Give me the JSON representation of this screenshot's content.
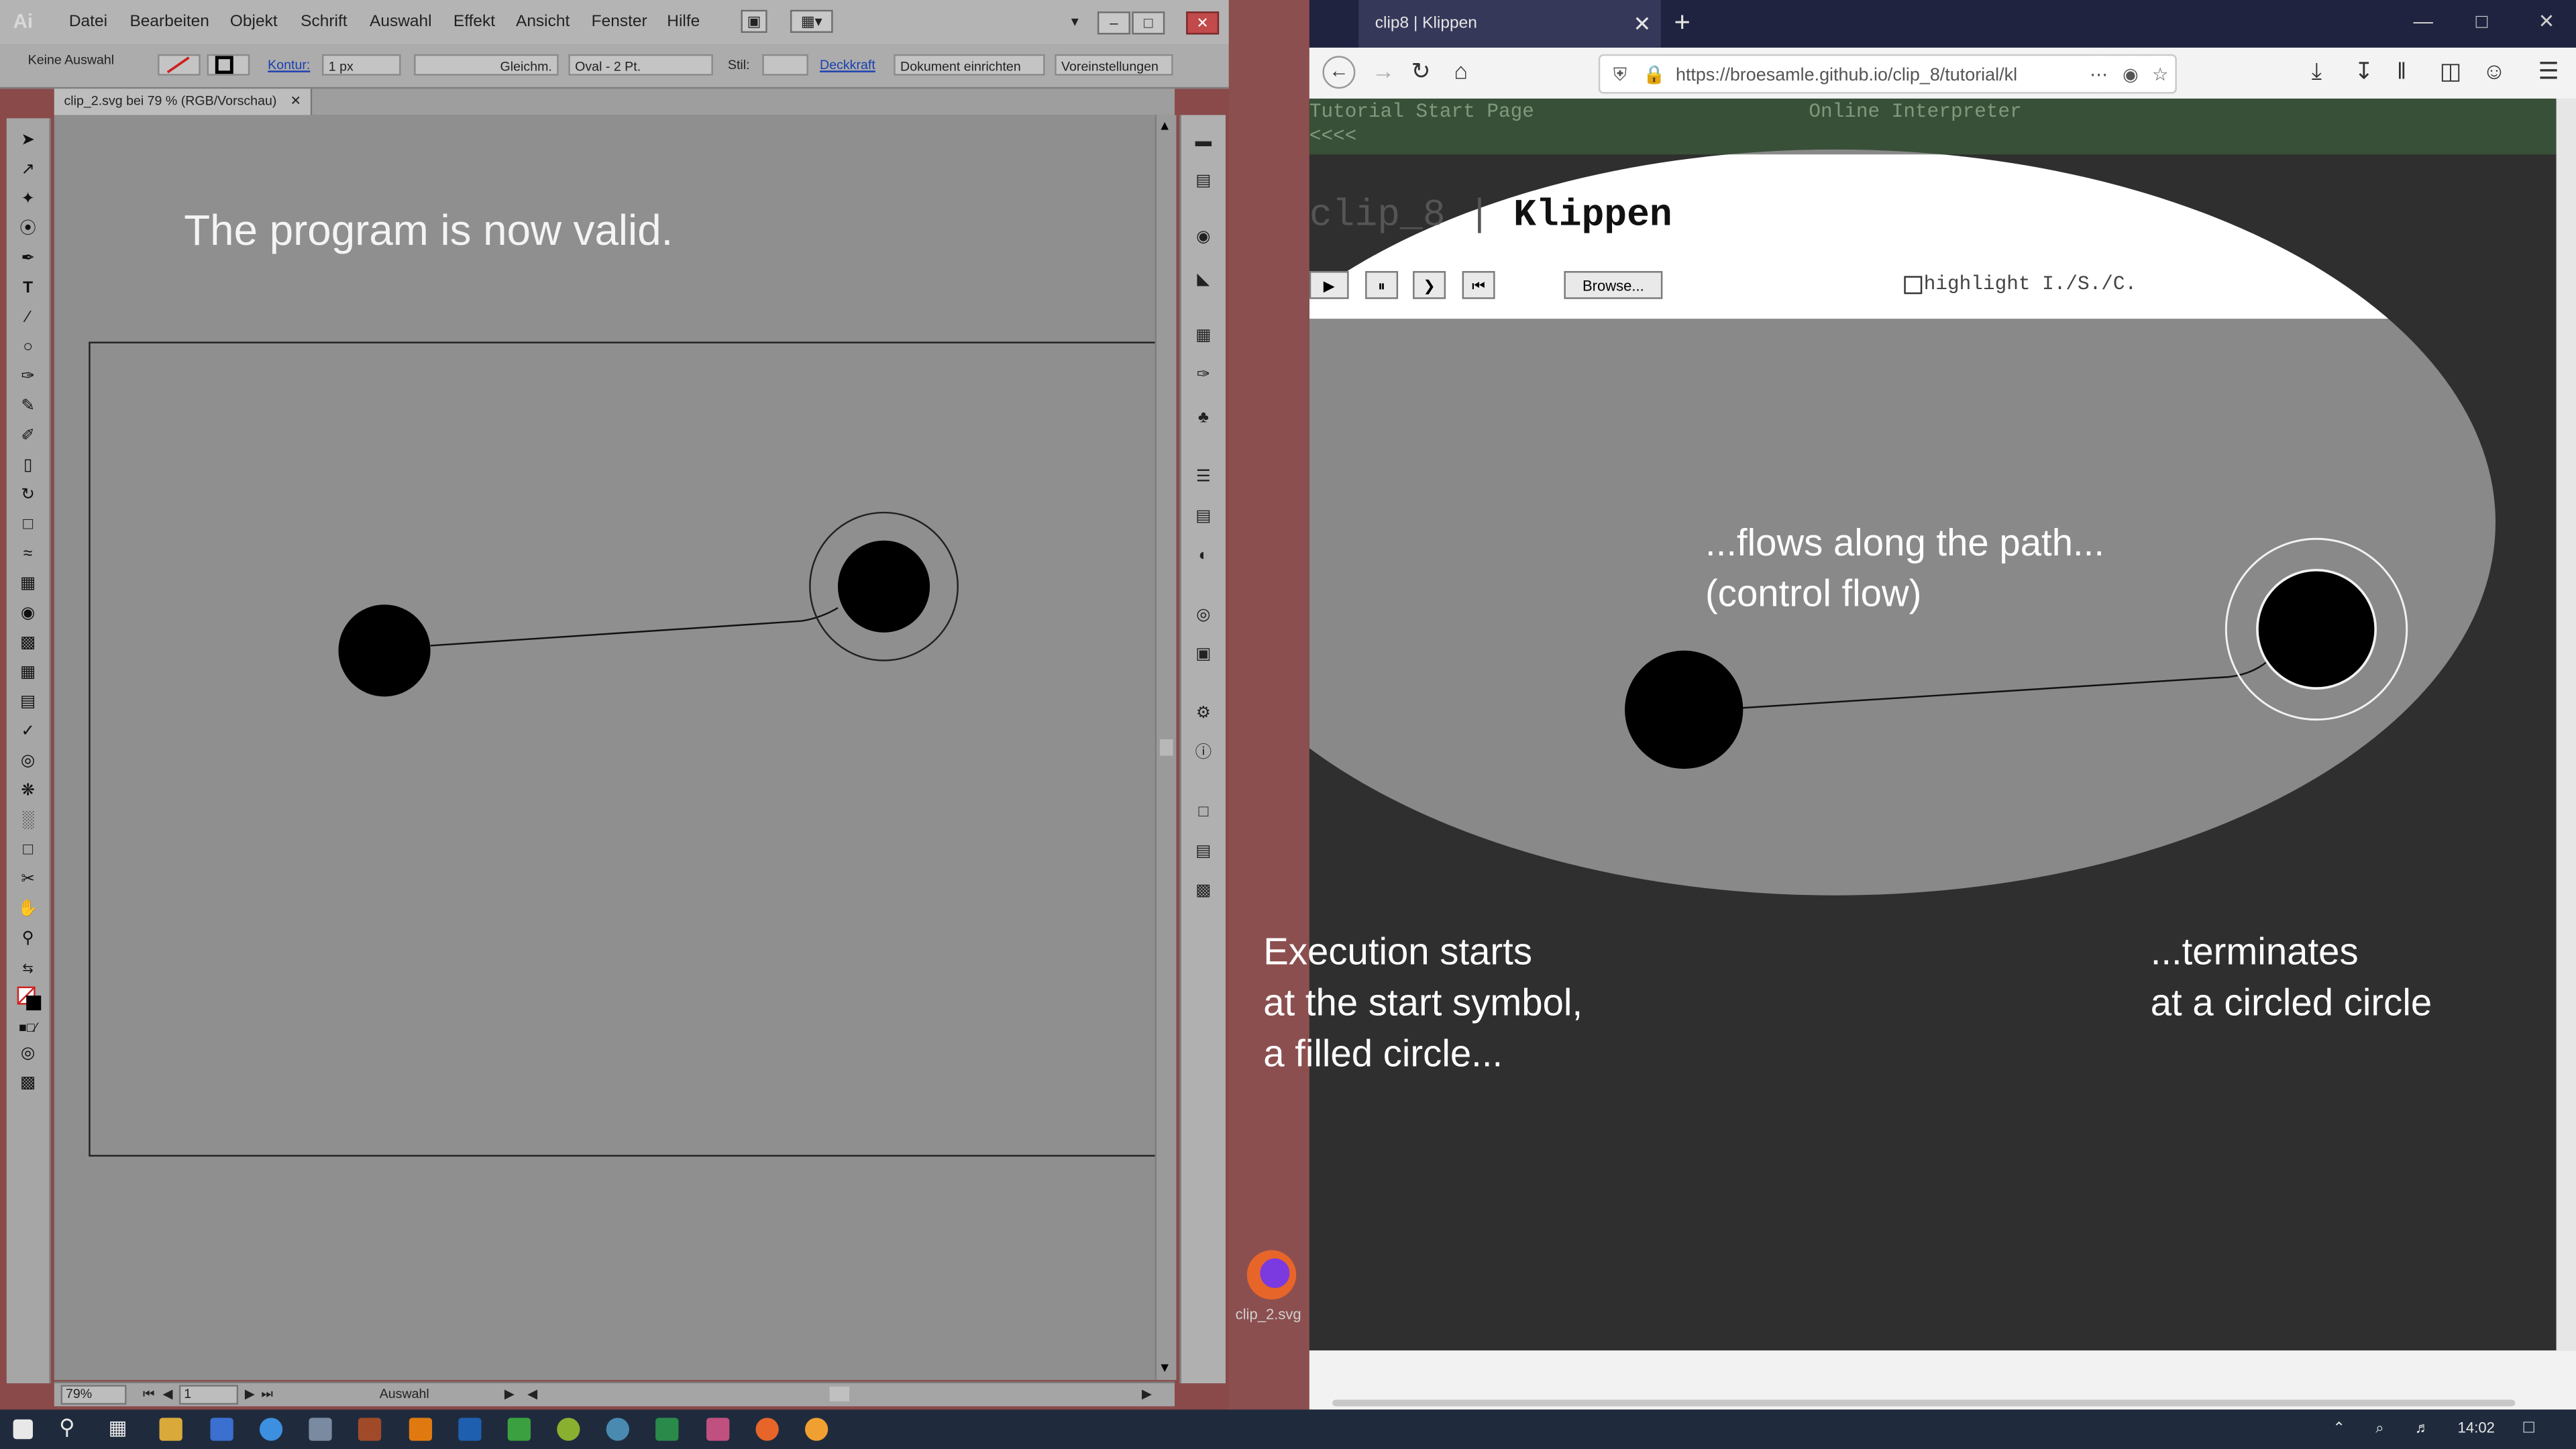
{
  "illustrator": {
    "logo": "Ai",
    "menu": [
      "Datei",
      "Bearbeiten",
      "Objekt",
      "Schrift",
      "Auswahl",
      "Effekt",
      "Ansicht",
      "Fenster",
      "Hilfe"
    ],
    "control_bar": {
      "selection": "Keine Auswahl",
      "stroke_label": "Kontur:",
      "stroke_weight": "1 px",
      "stroke_profile": "Gleichm.",
      "brush": "Oval - 2 Pt.",
      "style_label": "Stil:",
      "opacity_link": "Deckkraft",
      "doc_setup": "Dokument einrichten",
      "preferences": "Voreinstellungen"
    },
    "document_tab": "clip_2.svg bei 79 % (RGB/Vorschau)",
    "canvas_title": "The program is now valid.",
    "status": {
      "zoom": "79%",
      "artboard": "1",
      "tool": "Auswahl"
    }
  },
  "desktop_icon": {
    "label": "clip_2.svg",
    "icon": "firefox-icon"
  },
  "firefox": {
    "tab_title": "clip8 | Klippen",
    "url": "https://broesamle.github.io/clip_8/tutorial/kl",
    "page": {
      "nav_left": "Tutorial Start Page",
      "nav_left_sub": "<<<<",
      "nav_right": "Online Interpreter",
      "title_prefix": "clip_8 | ",
      "title_bold": "Klippen",
      "buttons": {
        "play": "▶",
        "pause": "⏸",
        "step": "❯",
        "rewind": "⏮",
        "browse": "Browse..."
      },
      "highlight_label": "highlight I./S./C.",
      "highlight_checked": false,
      "caption_flow_1": "...flows along the path...",
      "caption_flow_2": "(control flow)",
      "caption_start_1": "Execution starts",
      "caption_start_2": "at the start symbol,",
      "caption_start_3": "a filled circle...",
      "caption_end_1": "...terminates",
      "caption_end_2": "at a circled circle"
    }
  },
  "taskbar": {
    "clock": "14:02",
    "apps": [
      "start-icon",
      "search-icon",
      "task-view-icon",
      "explorer-icon",
      "save-icon",
      "sync-icon",
      "app-icon",
      "app-icon",
      "illustrator-icon",
      "photoshop-icon",
      "chart-icon",
      "qgis-icon",
      "app-icon",
      "excel-icon",
      "app-icon",
      "firefox-icon",
      "app-icon"
    ]
  },
  "colors": {
    "ai_canvas": "#8f8f8f",
    "page_bg": "#2f2f2f",
    "spotlight": "#898989",
    "green_bar": "#395038",
    "gap": "#8c4f4f",
    "taskbar": "#1f2b3d"
  }
}
